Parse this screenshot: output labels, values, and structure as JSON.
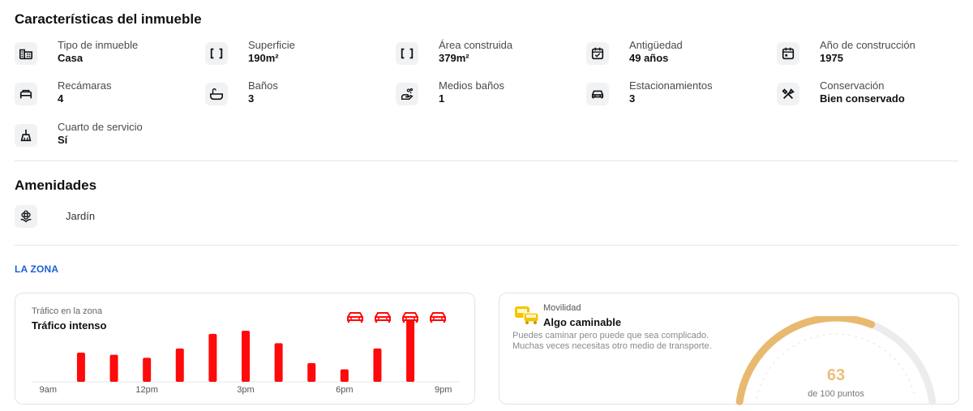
{
  "characteristics": {
    "title": "Características del inmueble",
    "items": [
      {
        "label": "Tipo de inmueble",
        "value": "Casa",
        "icon": "building-icon"
      },
      {
        "label": "Superficie",
        "value": "190m²",
        "icon": "area-brackets-icon"
      },
      {
        "label": "Área construida",
        "value": "379m²",
        "icon": "area-brackets-icon"
      },
      {
        "label": "Antigüedad",
        "value": "49 años",
        "icon": "calendar-check-icon"
      },
      {
        "label": "Año de construcción",
        "value": "1975",
        "icon": "calendar-icon"
      },
      {
        "label": "Recámaras",
        "value": "4",
        "icon": "bed-icon"
      },
      {
        "label": "Baños",
        "value": "3",
        "icon": "bathtub-icon"
      },
      {
        "label": "Medios baños",
        "value": "1",
        "icon": "hand-wash-icon"
      },
      {
        "label": "Estacionamientos",
        "value": "3",
        "icon": "car-icon"
      },
      {
        "label": "Conservación",
        "value": "Bien conservado",
        "icon": "tools-icon"
      },
      {
        "label": "Cuarto de servicio",
        "value": "Sí",
        "icon": "broom-icon"
      }
    ]
  },
  "amenities": {
    "title": "Amenidades",
    "items": [
      {
        "label": "Jardín",
        "icon": "flower-icon"
      }
    ]
  },
  "zone": {
    "title": "LA ZONA",
    "traffic": {
      "label": "Tráfico en la zona",
      "value": "Tráfico intenso",
      "level_cars": 4,
      "accent_color": "#ff0a0a",
      "chart_data": {
        "type": "bar",
        "x_ticks": [
          "9am",
          "12pm",
          "3pm",
          "6pm",
          "9pm"
        ],
        "values": [
          0,
          28,
          26,
          23,
          32,
          46,
          49,
          37,
          18,
          12,
          32,
          60,
          0
        ],
        "ylim": [
          0,
          70
        ],
        "grid": false
      }
    },
    "mobility": {
      "label": "Movilidad",
      "value": "Algo caminable",
      "description": "Puedes caminar pero puede que sea complicado. Muchas veces necesitas otro medio de transporte.",
      "score": "63",
      "score_suffix": "de 100 puntos",
      "score_value": 63,
      "score_max": 100,
      "gauge_color": "#e8b96e",
      "icon_color": "#f6c400"
    }
  }
}
